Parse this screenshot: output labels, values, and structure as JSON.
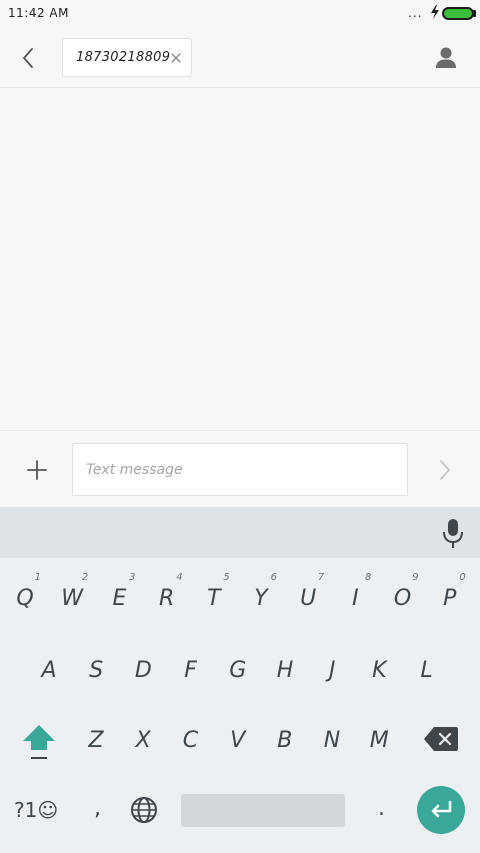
{
  "status_bar": {
    "time": "11:42 AM",
    "more_dots": "..."
  },
  "header": {
    "recipient": "18730218809"
  },
  "compose": {
    "placeholder": "Text message"
  },
  "keyboard": {
    "row1": [
      {
        "letter": "Q",
        "hint": "1"
      },
      {
        "letter": "W",
        "hint": "2"
      },
      {
        "letter": "E",
        "hint": "3"
      },
      {
        "letter": "R",
        "hint": "4"
      },
      {
        "letter": "T",
        "hint": "5"
      },
      {
        "letter": "Y",
        "hint": "6"
      },
      {
        "letter": "U",
        "hint": "7"
      },
      {
        "letter": "I",
        "hint": "8"
      },
      {
        "letter": "O",
        "hint": "9"
      },
      {
        "letter": "P",
        "hint": "0"
      }
    ],
    "row2": [
      "A",
      "S",
      "D",
      "F",
      "G",
      "H",
      "J",
      "K",
      "L"
    ],
    "row3": [
      "Z",
      "X",
      "C",
      "V",
      "B",
      "N",
      "M"
    ],
    "symbols_label": "?1☺",
    "comma": ",",
    "period": ".",
    "accent_color": "#3aa898"
  }
}
